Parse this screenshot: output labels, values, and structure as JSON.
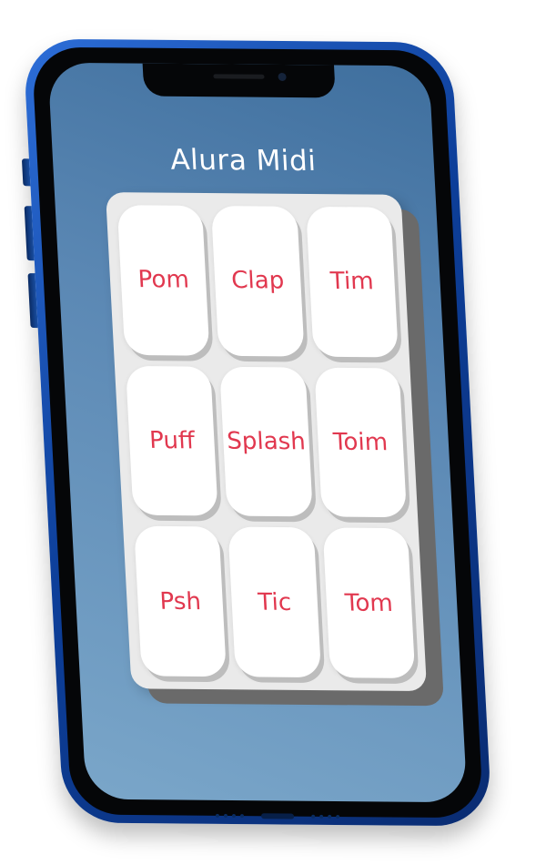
{
  "app": {
    "title": "Alura Midi"
  },
  "pads": [
    {
      "label": "Pom"
    },
    {
      "label": "Clap"
    },
    {
      "label": "Tim"
    },
    {
      "label": "Puff"
    },
    {
      "label": "Splash"
    },
    {
      "label": "Toim"
    },
    {
      "label": "Psh"
    },
    {
      "label": "Tic"
    },
    {
      "label": "Tom"
    }
  ],
  "colors": {
    "screen_background": "#5b88b4",
    "pad_label": "#e1384f",
    "pad_face": "#ffffff",
    "board": "#eaeaea",
    "frame": "#0d3f9a"
  }
}
